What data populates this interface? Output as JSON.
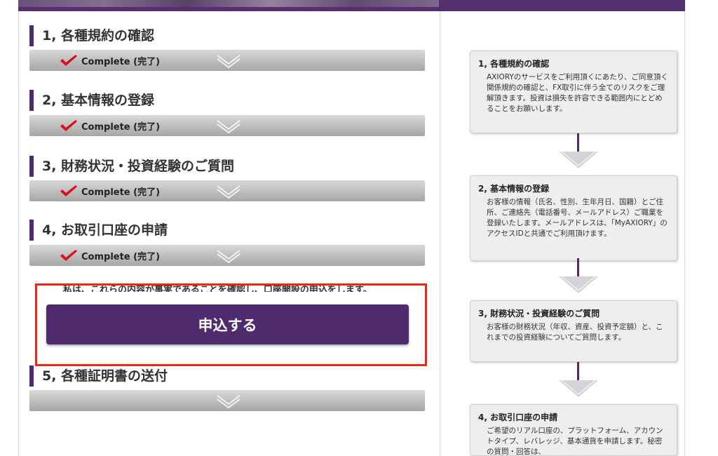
{
  "steps": [
    {
      "title": "1, 各種規約の確認",
      "status": "Complete (完了)"
    },
    {
      "title": "2, 基本情報の登録",
      "status": "Complete (完了)"
    },
    {
      "title": "3, 財務状況・投資経験のご質問",
      "status": "Complete (完了)"
    },
    {
      "title": "4, お取引口座の申請",
      "status": "Complete (完了)"
    },
    {
      "title": "5, 各種証明書の送付",
      "status": ""
    }
  ],
  "confirm_text": "私は、これらの内容が事実であることを確認し、口座開設の申込をします。",
  "apply_button": "申込する",
  "info_cards": [
    {
      "title": "1, 各種規約の確認",
      "body": "AXIORYのサービスをご利用頂くにあたり、ご同意頂く関係規約の確認と、FX取引に伴う全てのリスクをご理解頂きます。投資は損失を許容できる範囲内にとどめることをお願いします。"
    },
    {
      "title": "2, 基本情報の登録",
      "body": "お客様の情報（氏名、性別、生年月日、国籍）とご住所、ご連絡先（電話番号、メールアドレス）ご職業を登録いたします。メールアドレスは、「MyAXIORY」のアクセスIDと共通でご利用頂けます。"
    },
    {
      "title": "3, 財務状況・投資経験のご質問",
      "body": "お客様の財務状況（年収、資産、投資予定額）と、これまでの投資経験についてご質問します。"
    },
    {
      "title": "4, お取引口座の申請",
      "body": "ご希望のリアル口座の、プラットフォーム、アカウントタイプ、レバレッジ、基本通貨を申請します。秘密の質問・回答は、"
    }
  ],
  "colors": {
    "brand_purple": "#4f2a6d",
    "highlight_red": "#e62a1a",
    "check_red": "#d8101a"
  },
  "icons": {
    "complete": "check-icon",
    "expand": "chevron-down-icon",
    "flow": "arrow-down-icon"
  }
}
